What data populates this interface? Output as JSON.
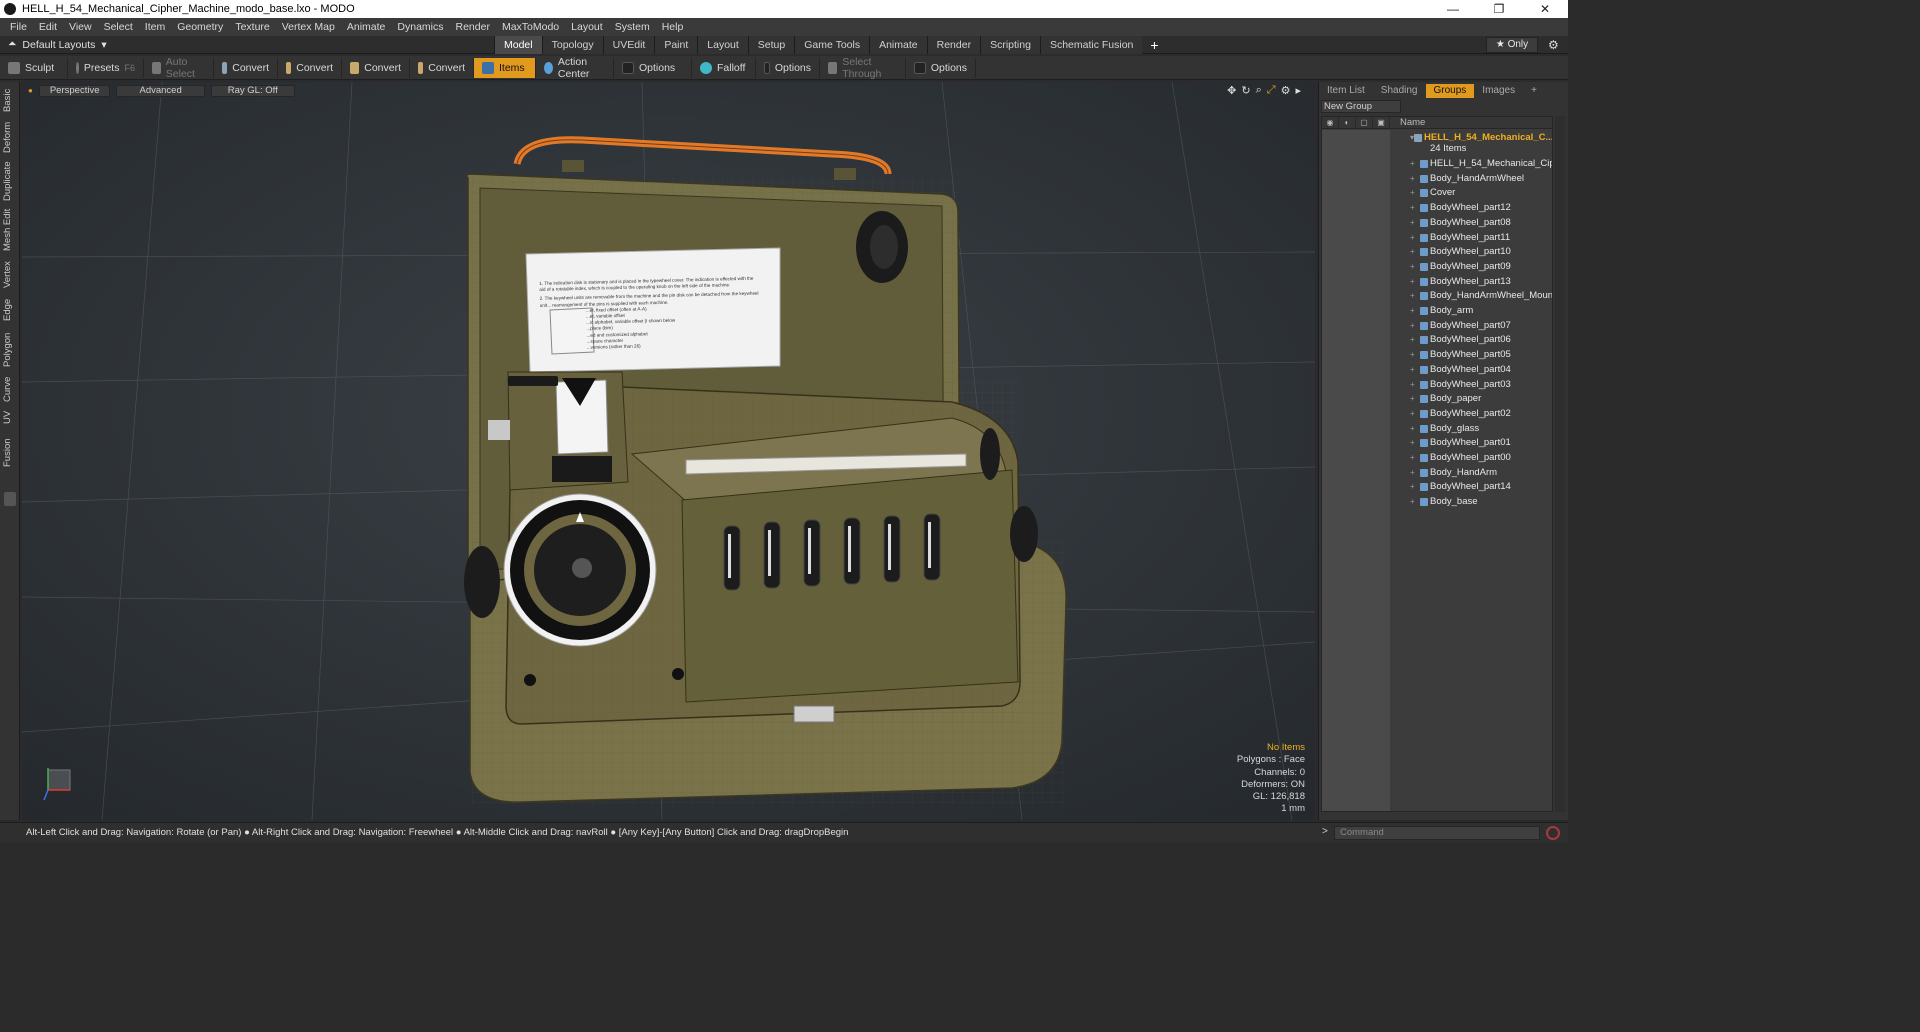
{
  "window": {
    "title": "HELL_H_54_Mechanical_Cipher_Machine_modo_base.lxo - MODO",
    "minimize": "—",
    "maximize": "❐",
    "close": "✕"
  },
  "menu": [
    "File",
    "Edit",
    "View",
    "Select",
    "Item",
    "Geometry",
    "Texture",
    "Vertex Map",
    "Animate",
    "Dynamics",
    "Render",
    "MaxToModo",
    "Layout",
    "System",
    "Help"
  ],
  "layoutbar": {
    "layouts_label": "Default Layouts",
    "tabs": [
      "Model",
      "Topology",
      "UVEdit",
      "Paint",
      "Layout",
      "Setup",
      "Game Tools",
      "Animate",
      "Render",
      "Scripting",
      "Schematic Fusion"
    ],
    "active_tab": "Model",
    "only_label": "★  Only"
  },
  "toolbar": {
    "sculpt": "Sculpt",
    "presets": "Presets",
    "presets_key": "F6",
    "auto_select": "Auto Select",
    "convert1": "Convert",
    "convert2": "Convert",
    "convert3": "Convert",
    "convert4": "Convert",
    "items": "Items",
    "action_center": "Action Center",
    "options1": "Options",
    "falloff": "Falloff",
    "options2": "Options",
    "select_through": "Select Through",
    "options3": "Options"
  },
  "left_tabs": [
    "Basic",
    "Deform",
    "Duplicate",
    "Mesh Edit",
    "Vertex",
    "Edge",
    "Polygon",
    "Curve",
    "UV",
    "Fusion"
  ],
  "viewport": {
    "view_mode": "Perspective",
    "shading": "Advanced",
    "raygl": "Ray GL: Off",
    "info": {
      "selection": "No Items",
      "polygons": "Polygons : Face",
      "channels": "Channels: 0",
      "deformers": "Deformers: ON",
      "gl": "GL: 126,818",
      "scale": "1 mm"
    },
    "paper_lines": [
      "1. The indication disk is stationary and is placed in the typewheel cover. The indication is effected with the",
      "aid of a rotatable index, which is coupled to the operating knob on the left side of the machine.",
      "2. The keywheel units are removable from the machine and the pin disk can be detached from the keywheel",
      "unit... rearrangement of the pins is supplied with each machine.",
      "...et, fixed offset (often at A-A)",
      "...et, variable offset",
      "...ic alphabet, variable offset (I shown below",
      "...place (bim)",
      "...ed and customized alphabet",
      "...space character",
      "...versions (rather than 26)"
    ]
  },
  "right_panel": {
    "tabs": [
      "Item List",
      "Shading",
      "Groups",
      "Images"
    ],
    "active_tab": "Groups",
    "new_group": "New Group",
    "name_header": "Name",
    "group_name": "HELL_H_54_Mechanical_C...",
    "item_count": "24 Items",
    "items": [
      "HELL_H_54_Mechanical_Cip ...",
      "Body_HandArmWheel",
      "Cover",
      "BodyWheel_part12",
      "BodyWheel_part08",
      "BodyWheel_part11",
      "BodyWheel_part10",
      "BodyWheel_part09",
      "BodyWheel_part13",
      "Body_HandArmWheel_Mount",
      "Body_arm",
      "BodyWheel_part07",
      "BodyWheel_part06",
      "BodyWheel_part05",
      "BodyWheel_part04",
      "BodyWheel_part03",
      "Body_paper",
      "BodyWheel_part02",
      "Body_glass",
      "BodyWheel_part01",
      "BodyWheel_part00",
      "Body_HandArm",
      "BodyWheel_part14",
      "Body_base"
    ]
  },
  "statusbar": {
    "hint": "Alt-Left Click and Drag: Navigation: Rotate (or Pan) ● Alt-Right Click and Drag: Navigation: Freewheel ● Alt-Middle Click and Drag: navRoll ● [Any Key]-[Any Button] Click and Drag: dragDropBegin",
    "command_placeholder": "Command"
  },
  "colors": {
    "accent": "#e29a1e",
    "machine_olive": "#6e6640",
    "handle_orange": "#e07a2a",
    "group_label": "#f0b020"
  }
}
